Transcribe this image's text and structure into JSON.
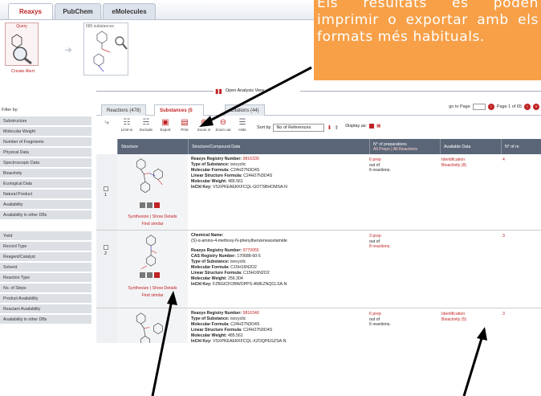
{
  "top_tabs": [
    "Reaxys",
    "PubChem",
    "eMolecules"
  ],
  "query": {
    "label": "Query",
    "create_alert": "Create Alert"
  },
  "substances_box": {
    "label": "585 substances"
  },
  "callout": {
    "text": "Els resultats es poden imprimir o exportar amb els formats més habituals."
  },
  "analysis_view": {
    "label": "Open Analysis View"
  },
  "filter": {
    "title": "Filter by:",
    "group1": [
      "Substructure",
      "Molecular Weight",
      "Number of Fragments",
      "Physical Data",
      "Spectroscopic Data",
      "Bioactivity",
      "Ecological Data",
      "Natural Product",
      "Availability",
      "Availability in other DBs"
    ],
    "group2": [
      "Yield",
      "Record Type",
      "Reagent/Catalyst",
      "Solvent",
      "Reaction Type",
      "No. of Steps",
      "Product Availability",
      "Reactant Availability",
      "Availability in other DBs"
    ]
  },
  "tabs": [
    {
      "label": "Reactions (478)"
    },
    {
      "label": "Substances (5"
    },
    {
      "label": "Citations (44)"
    }
  ],
  "goto": {
    "label": "go to Page",
    "page_text": "Page 1 of 65"
  },
  "toolbar": {
    "limit_to": "Limit to",
    "exclude": "Exclude",
    "export": "Export",
    "print": "Print",
    "zoom_in": "Zoom in",
    "zoom_out": "Zoom out",
    "hide": "Hide",
    "sort_by": "Sort by",
    "sort_value": "No of References",
    "display_as": "Display as:"
  },
  "columns": {
    "structure": "Structure",
    "compound": "Structure/Compound Data",
    "preps": "N° of preparations",
    "preps_links": "All Preps | All Reactions",
    "available": "Available Data",
    "nref": "N° of re"
  },
  "rows": [
    {
      "num": "1",
      "links": "Synthesize | Show Details",
      "find": "Find similar",
      "lines": [
        {
          "k": "Reaxys Registry Number:",
          "v": " 9816339",
          "red": true
        },
        {
          "k": "Type of Substance:",
          "v": " isocyclic"
        },
        {
          "k": "Molecular Formula:",
          "v": " C24H27N3O4S"
        },
        {
          "k": "Linear Structure Formula:",
          "v": " C24H27N3O4S"
        },
        {
          "k": "Molecular Weight:",
          "v": " 485.561"
        },
        {
          "k": "InChI Key:",
          "v": " VSXPKEAEKKFCQL-GOTSBHOMSA-N"
        }
      ],
      "preps": [
        "6 prep",
        "out of",
        "6 reactions."
      ],
      "avail": [
        "Identification",
        "Bioactivity (8)"
      ],
      "nref": "4"
    },
    {
      "num": "2",
      "links": "Synthesize | Show Details",
      "find": "Find similar",
      "lines": [
        {
          "k": "Chemical Name:",
          "v": ""
        },
        {
          "k": "",
          "v": "(S)-α-amino-4-methoxy-N-phenylbenzeneacetamide"
        },
        {
          "k": "",
          "v": ""
        },
        {
          "k": "Reaxys Registry Number:",
          "v": " 9770055",
          "red": true
        },
        {
          "k": "CAS Registry Number:",
          "v": " 170688-60-5"
        },
        {
          "k": "Type of Substance:",
          "v": " isocyclic"
        },
        {
          "k": "Molecular Formula:",
          "v": " C15H16N2O2"
        },
        {
          "k": "Linear Structure Formula:",
          "v": " C15H16N2O2"
        },
        {
          "k": "Molecular Weight:",
          "v": " 256.304"
        },
        {
          "k": "InChI Key:",
          "v": " FZBGICFOBWOPPS-AWEZNQCLSA-N"
        }
      ],
      "preps": [
        "3 prep",
        "out of",
        "8 reactions."
      ],
      "avail": [],
      "nref": "3"
    },
    {
      "num": "3",
      "links": "",
      "find": "",
      "lines": [
        {
          "k": "Reaxys Registry Number:",
          "v": " 9816340",
          "red": true
        },
        {
          "k": "Type of Substance:",
          "v": " isocyclic"
        },
        {
          "k": "Molecular Formula:",
          "v": " C24H27N3O4S"
        },
        {
          "k": "Linear Structure Formula:",
          "v": " C24H27N3O4S"
        },
        {
          "k": "Molecular Weight:",
          "v": " 485.561"
        },
        {
          "k": "InChI Key:",
          "v": " VSXPKEAEKKFCQL-XZOQPEGZSA-N"
        }
      ],
      "preps": [
        "6 prep",
        "out of",
        "6 reactions."
      ],
      "avail": [
        "Identification",
        "Bioactivity (5)"
      ],
      "nref": "3"
    }
  ]
}
